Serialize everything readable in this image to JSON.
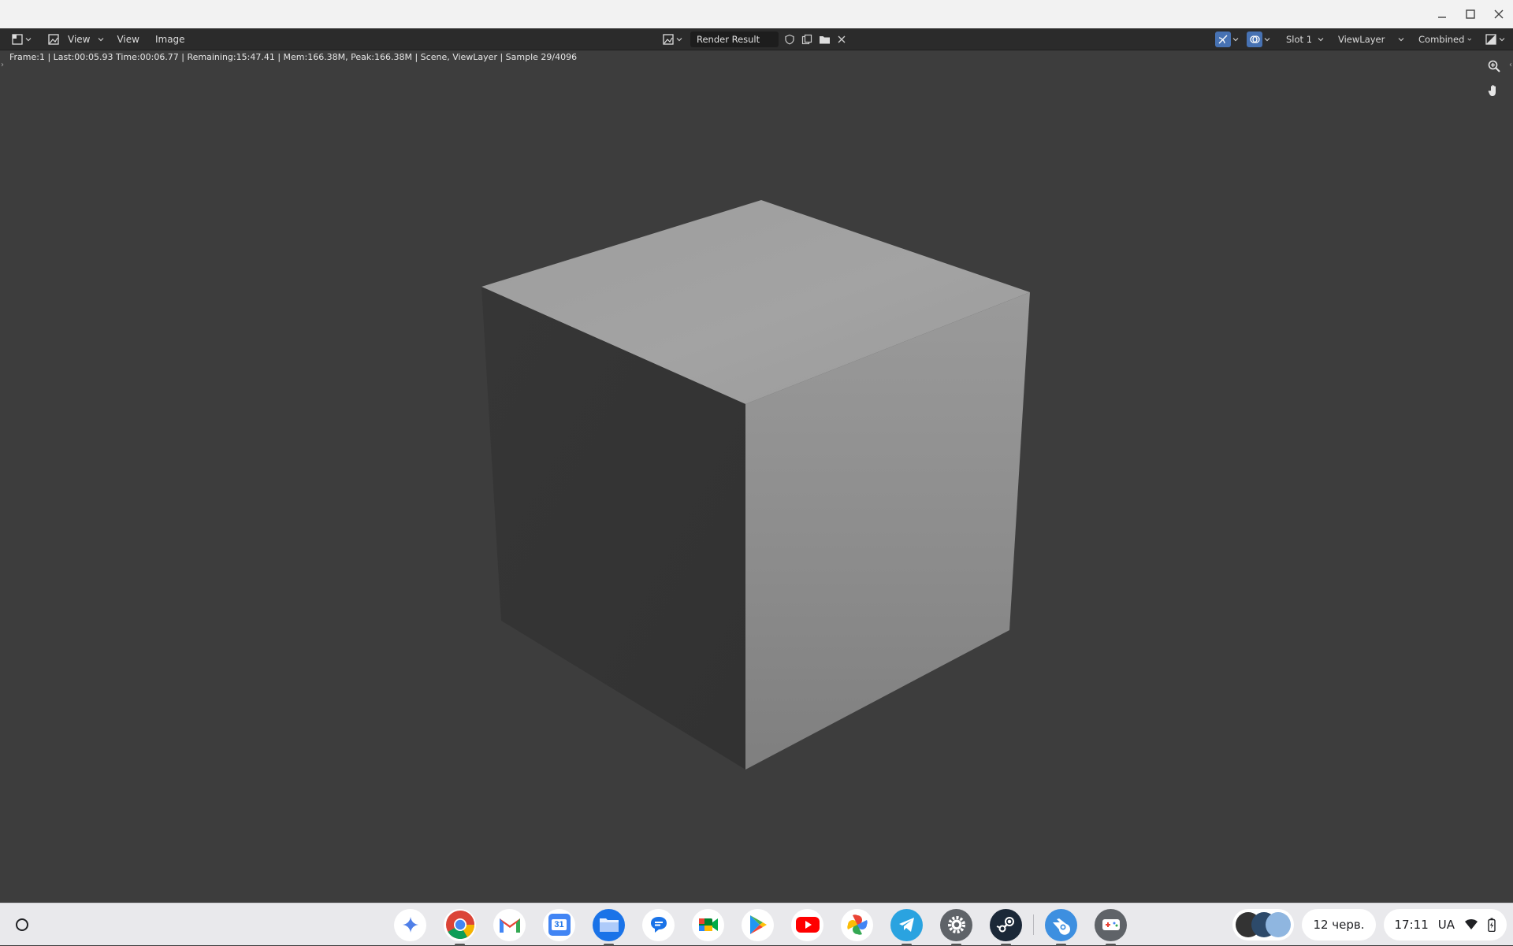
{
  "header": {
    "menus": {
      "view_1": "View",
      "view_2": "View",
      "image": "Image"
    },
    "image_name": "Render Result",
    "slot": "Slot 1",
    "view_layer": "ViewLayer",
    "pass": "Combined"
  },
  "status": {
    "text": "Frame:1 | Last:00:05.93 Time:00:06.77 | Remaining:15:47.41 | Mem:166.38M, Peak:166.38M | Scene, ViewLayer | Sample 29/4096"
  },
  "shelf": {
    "apps": [
      "gemini-icon",
      "chrome-icon",
      "gmail-icon",
      "calendar-icon",
      "files-icon",
      "messages-icon",
      "meet-icon",
      "play-store-icon",
      "youtube-icon",
      "photos-icon",
      "telegram-icon",
      "settings-icon",
      "steam-icon",
      "blender-icon",
      "game-icon"
    ],
    "calendar_day": "31",
    "date": "12 черв.",
    "time": "17:11",
    "keyboard": "UA"
  },
  "colors": {
    "accent": "#4772b3",
    "viewport_bg": "#3d3d3d",
    "header_bg": "#2b2b2b",
    "shelf_bg": "#e9e9ec"
  }
}
